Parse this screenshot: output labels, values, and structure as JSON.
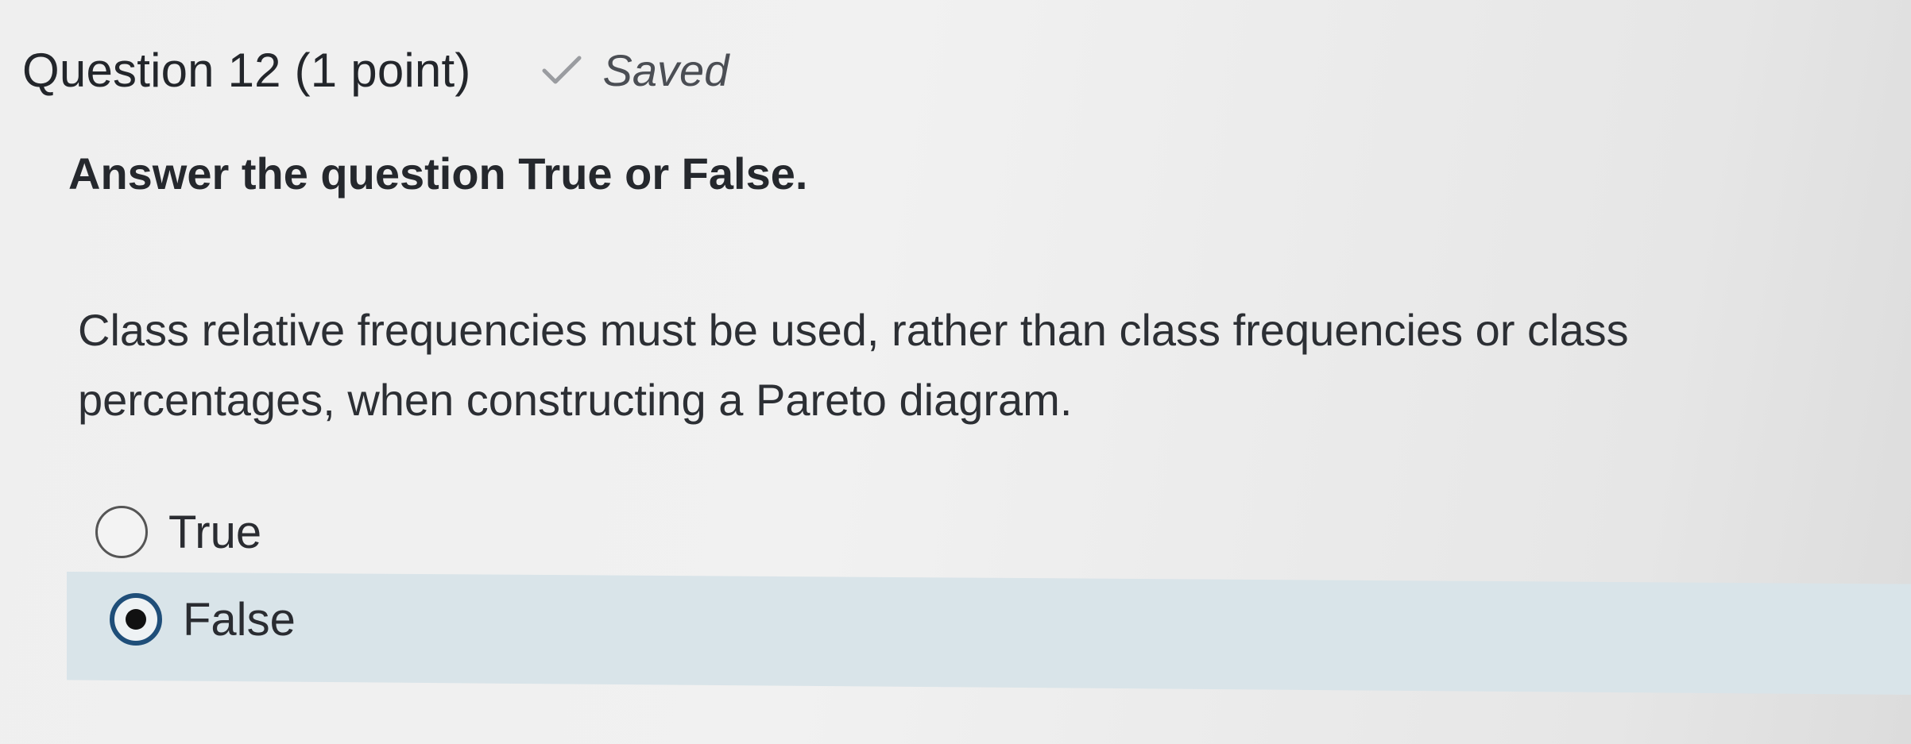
{
  "question": {
    "title": "Question 12 (1 point)",
    "status": "Saved",
    "status_icon": "check-icon",
    "instruction": "Answer the question True or False.",
    "prompt": "Class relative frequencies must be used, rather than class frequencies or class percentages, when constructing a Pareto diagram."
  },
  "options": [
    {
      "label": "True",
      "selected": false
    },
    {
      "label": "False",
      "selected": true
    }
  ],
  "colors": {
    "selected_row_background": "#d9e4e9",
    "selected_radio_ring": "#1f4e79"
  }
}
